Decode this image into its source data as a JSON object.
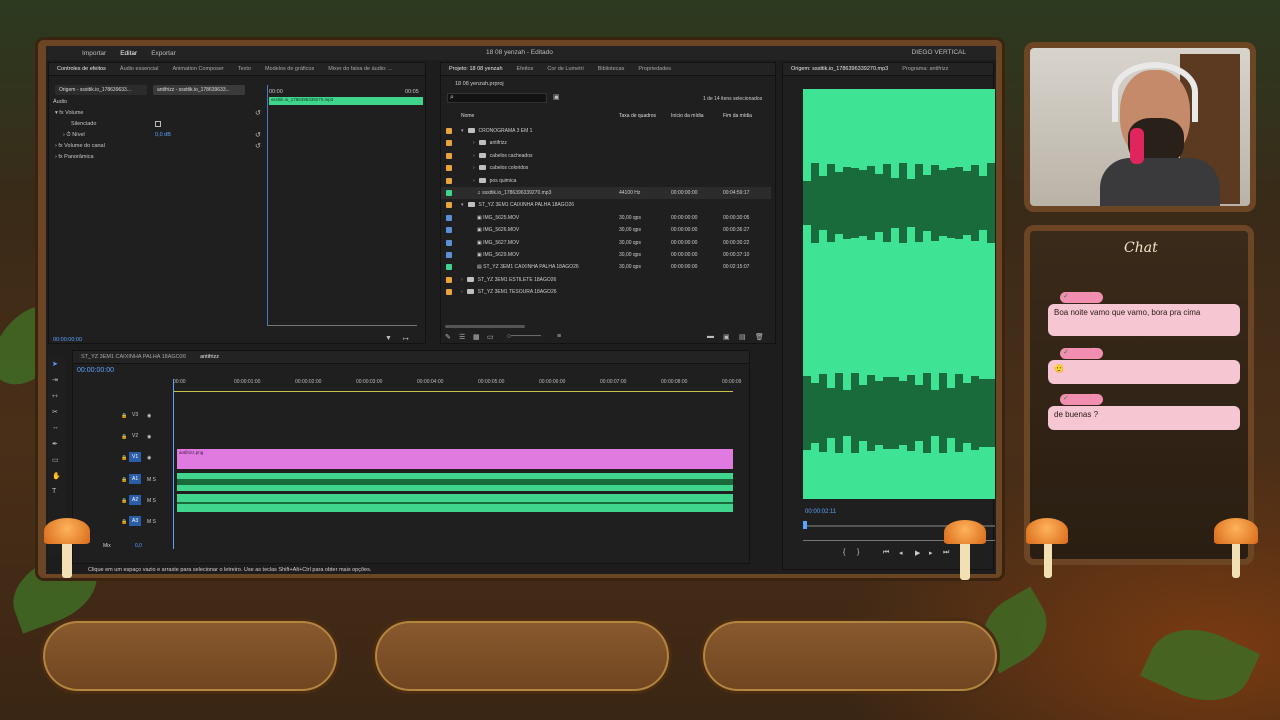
{
  "premiere": {
    "workspace_tabs": [
      "Importar",
      "Editar",
      "Exportar"
    ],
    "active_workspace": "Editar",
    "doc_title": "18 08 yenzah - Editado",
    "workspace_name": "DIEGO VERTICAL"
  },
  "effect_controls": {
    "tabs": [
      "Controles de efeitos",
      "Áudio essencial",
      "Animation Composer",
      "Texto",
      "Modelos de gráficos",
      "Mixer do faixa de áudio: ..."
    ],
    "source_label": "Origem - sssttik.io_178639633...",
    "sequence_label": "antifrizz - sssttik.io_178639633...",
    "section": "Áudio",
    "timecode_start": "00:00",
    "timecode_end": "00:05",
    "clip_name": "sssttik.io_1786396339270.mp3",
    "rows": [
      "Volume",
      "Silenciado",
      "Nível",
      "Volume do canal",
      "Panorâmica"
    ],
    "level_value": "0,0 dB",
    "current_time": "00:00:00:00"
  },
  "project": {
    "tabs": [
      "Projeto: 18 08 yenzah",
      "Efeitos",
      "Cor de Lumetri",
      "Bibliotecas",
      "Propriedades"
    ],
    "file_name": "18 08 yenzah.prproj",
    "count": "1 de 14 itens selecionados",
    "columns": [
      "Nome",
      "Taxa de quadros",
      "Início da mídia",
      "Fim da mídia"
    ],
    "rows": [
      {
        "name": "CRONOGRAMA 3 EM 1",
        "fps": "",
        "start": "",
        "end": "",
        "level": 0,
        "type": "folder",
        "color": "#e8a33a"
      },
      {
        "name": "antifrizz",
        "fps": "",
        "start": "",
        "end": "",
        "level": 1,
        "type": "folder",
        "color": "#e8a33a"
      },
      {
        "name": "cabelos cacheados",
        "fps": "",
        "start": "",
        "end": "",
        "level": 1,
        "type": "folder",
        "color": "#e8a33a"
      },
      {
        "name": "cabelos coloridos",
        "fps": "",
        "start": "",
        "end": "",
        "level": 1,
        "type": "folder",
        "color": "#e8a33a"
      },
      {
        "name": "pos quimica",
        "fps": "",
        "start": "",
        "end": "",
        "level": 1,
        "type": "folder",
        "color": "#e8a33a"
      },
      {
        "name": "sssttik.io_1786396339270.mp3",
        "fps": "44100 Hz",
        "start": "00:00:00:00",
        "end": "00:04:59:17",
        "level": 1,
        "type": "audio",
        "color": "#3fd58d"
      },
      {
        "name": "ST_YZ 3EM1 CAIXINHA PALHA 18AGO26",
        "fps": "",
        "start": "",
        "end": "",
        "level": 0,
        "type": "folder",
        "color": "#e8a33a"
      },
      {
        "name": "IMG_5625.MOV",
        "fps": "30,00 qps",
        "start": "00:00:00:00",
        "end": "00:00:30:05",
        "level": 1,
        "type": "video",
        "color": "#5b8fd6"
      },
      {
        "name": "IMG_5626.MOV",
        "fps": "30,00 qps",
        "start": "00:00:00:00",
        "end": "00:00:36:27",
        "level": 1,
        "type": "video",
        "color": "#5b8fd6"
      },
      {
        "name": "IMG_5627.MOV",
        "fps": "30,00 qps",
        "start": "00:00:00:00",
        "end": "00:00:30:22",
        "level": 1,
        "type": "video",
        "color": "#5b8fd6"
      },
      {
        "name": "IMG_5629.MOV",
        "fps": "30,00 qps",
        "start": "00:00:00:00",
        "end": "00:00:37:10",
        "level": 1,
        "type": "video",
        "color": "#5b8fd6"
      },
      {
        "name": "ST_YZ 3EM1 CAIXINHA PALHA 18AGO26",
        "fps": "30,00 qps",
        "start": "00:00:00:00",
        "end": "00:02:15:07",
        "level": 1,
        "type": "sequence",
        "color": "#3fd58d"
      },
      {
        "name": "ST_YZ 3EM1 ESTILETE 18AGO26",
        "fps": "",
        "start": "",
        "end": "",
        "level": 0,
        "type": "folder",
        "color": "#e8a33a"
      },
      {
        "name": "ST_YZ 3EM1 TESOURA 18AGO26",
        "fps": "",
        "start": "",
        "end": "",
        "level": 0,
        "type": "folder",
        "color": "#e8a33a"
      }
    ]
  },
  "source_monitor": {
    "tabs": [
      "Origem: sssttik.io_1786396339270.mp3",
      "Programa: antifrizz"
    ],
    "timecode": "00:00:02:11"
  },
  "timeline": {
    "tabs": [
      "ST_YZ 3EM1 CAIXINHA PALHA 18AGO26",
      "antifrizz"
    ],
    "timecode": "00:00:00:00",
    "ruler": [
      "00:00",
      "00:00:01:00",
      "00:00:02:00",
      "00:00:03:00",
      "00:00:04:00",
      "00:00:05:00",
      "00:00:06:00",
      "00:00:07:00",
      "00:00:08:00",
      "00:00:09"
    ],
    "tracks": [
      "V3",
      "V2",
      "V1",
      "A1",
      "A2",
      "A3"
    ],
    "mix_label": "Mix",
    "mix_value": "0,0",
    "video_clip": "antifrizz.png",
    "status": "Clique em um espaço vazio e arraste para selecionar o letreiro. Use as teclas Shift+Alt+Ctrl para obter mais opções."
  },
  "chat": {
    "title": "Chat",
    "messages": [
      {
        "user": "Yenzah",
        "text": "Boa noite vamo que vamo, bora pra cima"
      },
      {
        "user": "Yenzah",
        "text": "🫡"
      },
      {
        "user": "Yenzah",
        "text": "de buenas ?"
      }
    ]
  }
}
